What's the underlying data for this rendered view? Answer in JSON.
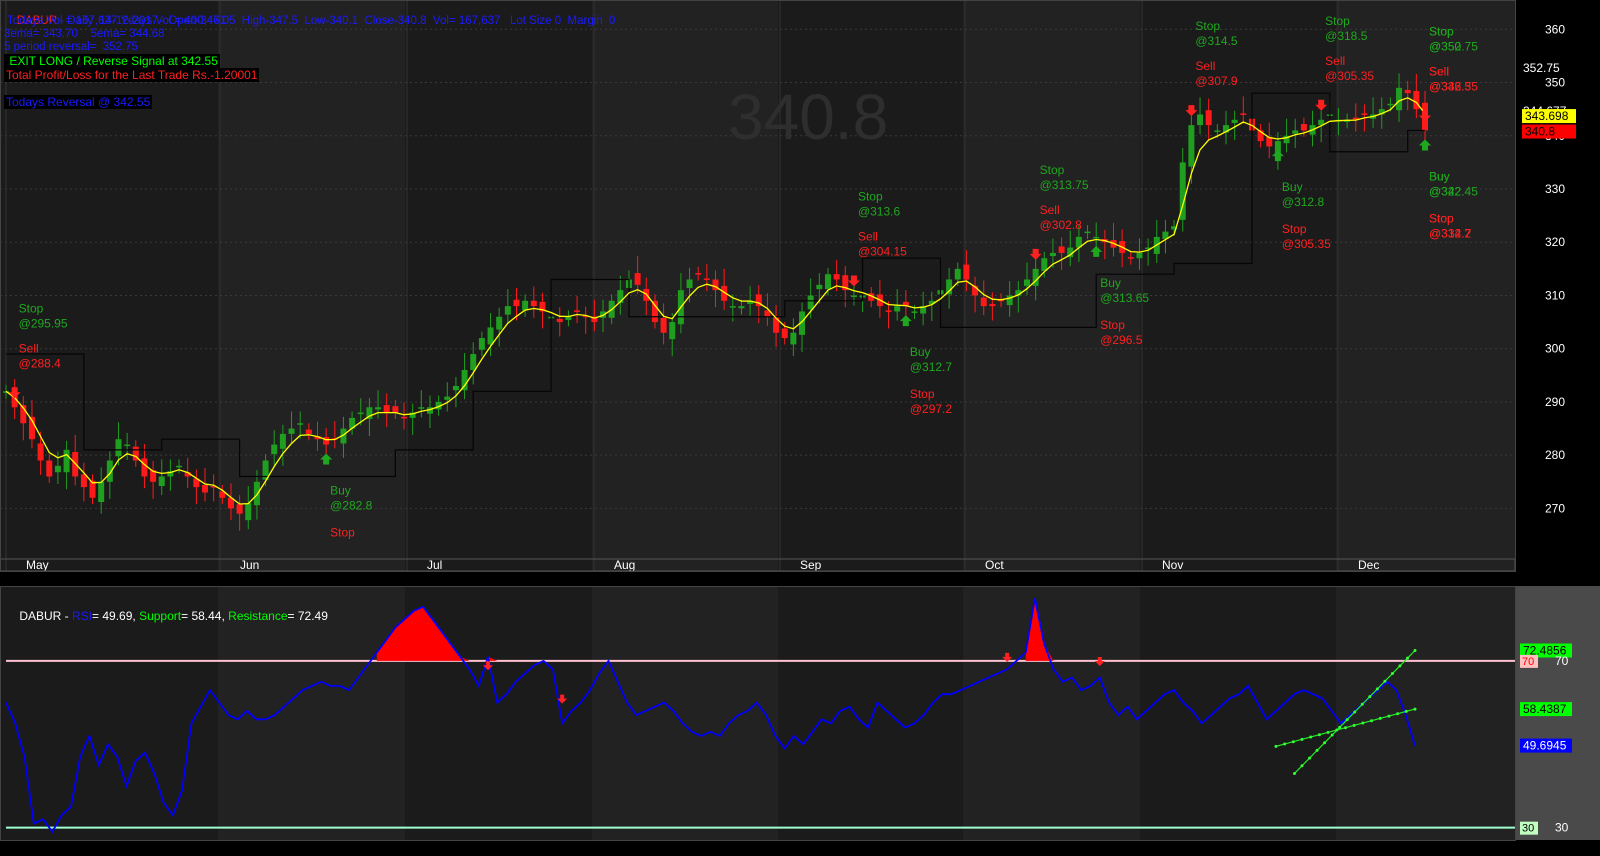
{
  "header": {
    "symbol": "DABUR",
    "info": " - Daily  14-12-2017 - Open-347.05  High-347.5  Low-340.1  Close-340.8  Vol= 167,637   Lot Size 0  Margin  0",
    "volume_line": " Todays Vol = 167,637 Ydays Vol = 400,461",
    "ema_line": "3ema= 343.70    5ema= 344.68",
    "reversal_line": "5 period reversal=  352.75",
    "exit_signal": " EXIT LONG / Reverse Signal at 342.55",
    "profit_loss": "Total Profit/Loss for the Last Trade Rs.-1.20001",
    "todays_reversal": "Todays Reversal @ 342.55",
    "watermark": "340.8"
  },
  "colors": {
    "background": "#000000",
    "panel": "#1a1a1a",
    "up_candle": "#1f9e1f",
    "down_candle": "#ff1a1a",
    "ema": "#ffff00",
    "stop_line": "#000000",
    "buy_text": "#1fa81f",
    "sell_text": "#ff2020",
    "rsi_line": "#0000ff",
    "axis_text": "#ffffff"
  },
  "chart_data": [
    {
      "type": "candlestick",
      "title": "DABUR - Daily",
      "x_months": [
        "May",
        "Jun",
        "Jul",
        "Aug",
        "Sep",
        "Oct",
        "Nov",
        "Dec"
      ],
      "y_ticks": [
        270,
        280,
        290,
        300,
        310,
        320,
        330,
        340,
        350,
        360
      ],
      "ylim": [
        262,
        364
      ],
      "series_closes": [
        292,
        289,
        286,
        283,
        279,
        276,
        278,
        281,
        276,
        274,
        272,
        275,
        279,
        283,
        282,
        279,
        276,
        275,
        276,
        277,
        278,
        276,
        274,
        273,
        274,
        272,
        270,
        269,
        271,
        275,
        279,
        282,
        284,
        285,
        286,
        284,
        283,
        282,
        283,
        285,
        287,
        288,
        289,
        289,
        288,
        288,
        287,
        288,
        289,
        289,
        290,
        291,
        293,
        296,
        299,
        302,
        304,
        306,
        308,
        308,
        309,
        308,
        307,
        306,
        305,
        306,
        307,
        306,
        305,
        307,
        309,
        311,
        313,
        312,
        309,
        305,
        303,
        305,
        311,
        313,
        314,
        313,
        311,
        309,
        308,
        308,
        309,
        308,
        306,
        303,
        302,
        303,
        307,
        310,
        312,
        314,
        313,
        311,
        310,
        310,
        309,
        308,
        307,
        308,
        308,
        307,
        308,
        309,
        311,
        313,
        315,
        313,
        310,
        308,
        308,
        309,
        310,
        311,
        313,
        315,
        317,
        318,
        318,
        319,
        321,
        322,
        321,
        320,
        319,
        318,
        317,
        318,
        319,
        321,
        322,
        323,
        335,
        342,
        344,
        342,
        341,
        342,
        343,
        344,
        341,
        339,
        338,
        339,
        340,
        341,
        341,
        342,
        343,
        344,
        343,
        343,
        343,
        344,
        344,
        345,
        346,
        349,
        348,
        345,
        341
      ],
      "ema_color": "#ffff00",
      "last_close": 340.8,
      "price_labels": [
        {
          "text": "352.75",
          "value": 352.75
        },
        {
          "text": "344.677",
          "value": 344.677
        },
        {
          "text": "343.698",
          "value": 343.698,
          "bg": "#ffff00",
          "fg": "#000000"
        },
        {
          "text": "340.8",
          "value": 340.8,
          "bg": "#ff0000",
          "fg": "#000000"
        }
      ],
      "signals": [
        {
          "kind": "Stop",
          "text": "@295.95",
          "series": "sell",
          "idx": 1,
          "place": "above2"
        },
        {
          "kind": "Sell",
          "text": "@288.4",
          "series": "sell",
          "idx": 1,
          "place": "above"
        },
        {
          "kind": "Buy",
          "text": "@282.8",
          "series": "buy",
          "idx": 37,
          "place": "below"
        },
        {
          "kind": "Stop",
          "text": "",
          "series": "sell",
          "idx": 37,
          "place": "below2"
        },
        {
          "kind": "Stop",
          "text": "@313.6",
          "series": "buy",
          "idx": 98,
          "place": "above2"
        },
        {
          "kind": "Sell",
          "text": "@304.15",
          "series": "sell",
          "idx": 98,
          "place": "above"
        },
        {
          "kind": "Buy",
          "text": "@312.7",
          "series": "buy",
          "idx": 104,
          "place": "below"
        },
        {
          "kind": "Stop",
          "text": "@297.2",
          "series": "sell",
          "idx": 104,
          "place": "below2"
        },
        {
          "kind": "Stop",
          "text": "@313.75",
          "series": "buy",
          "idx": 119,
          "place": "above2"
        },
        {
          "kind": "Sell",
          "text": "@302.8",
          "series": "sell",
          "idx": 119,
          "place": "above"
        },
        {
          "kind": "Buy",
          "text": "@313.65",
          "series": "buy",
          "idx": 126,
          "place": "below"
        },
        {
          "kind": "Stop",
          "text": "@296.5",
          "series": "sell",
          "idx": 126,
          "place": "below2"
        },
        {
          "kind": "Stop",
          "text": "@314.5",
          "series": "buy",
          "idx": 137,
          "place": "above2"
        },
        {
          "kind": "Sell",
          "text": "@307.9",
          "series": "sell",
          "idx": 137,
          "place": "above"
        },
        {
          "kind": "Buy",
          "text": "@312.8",
          "series": "buy",
          "idx": 147,
          "place": "below"
        },
        {
          "kind": "Stop",
          "text": "@305.35",
          "series": "sell",
          "idx": 147,
          "place": "below2"
        },
        {
          "kind": "Stop",
          "text": "@318.5",
          "series": "buy",
          "idx": 152,
          "place": "above2"
        },
        {
          "kind": "Sell",
          "text": "@305.35",
          "series": "sell",
          "idx": 152,
          "place": "above"
        },
        {
          "kind": "Buy",
          "text": "@322.45",
          "series": "buy",
          "idx": 171,
          "place": "below"
        },
        {
          "kind": "Stop",
          "text": "@312.2",
          "series": "sell",
          "idx": 171,
          "place": "below2"
        },
        {
          "kind": "Stop",
          "text": "@350",
          "series": "buy",
          "idx": 206,
          "place": "above2"
        },
        {
          "kind": "Sell",
          "text": "@336.3",
          "series": "sell",
          "idx": 206,
          "place": "above"
        },
        {
          "kind": "Buy",
          "text": "@342",
          "series": "buy",
          "idx": 217,
          "place": "below"
        },
        {
          "kind": "Stop",
          "text": "@334.7",
          "series": "sell",
          "idx": 217,
          "place": "below2"
        },
        {
          "kind": "Stop",
          "text": "@352.75",
          "series": "buy",
          "idx": 238,
          "place": "above2"
        },
        {
          "kind": "Sell",
          "text": "@342.55",
          "series": "sell",
          "idx": 238,
          "place": "above"
        }
      ]
    },
    {
      "type": "line",
      "title": "RSI",
      "legend": {
        "symbol": "DABUR - ",
        "rsi_label": "RSI",
        "rsi_value": "= 49.69",
        "support_label": "Support",
        "support_value": "= 58.44",
        "resistance_label": "Resistance",
        "resistance_value": "= 72.49"
      },
      "levels": [
        70,
        30
      ],
      "ylim": [
        28,
        87
      ],
      "rsi": [
        60,
        55,
        47,
        31,
        32,
        29,
        33,
        35,
        47,
        52,
        45,
        50,
        47,
        40,
        46,
        48,
        43,
        36,
        33,
        39,
        55,
        59,
        63,
        60,
        57,
        56,
        58,
        56,
        56,
        57,
        59,
        61,
        63,
        64,
        65,
        64,
        64,
        63,
        66,
        69,
        72,
        75,
        78,
        80,
        82,
        83,
        80,
        77,
        74,
        71,
        68,
        64,
        71,
        60,
        62,
        65,
        67,
        69,
        70,
        68,
        55,
        58,
        60,
        63,
        67,
        70,
        65,
        60,
        57,
        58,
        59,
        60,
        58,
        55,
        53,
        52,
        53,
        52,
        55,
        57,
        58,
        60,
        57,
        52,
        49,
        52,
        50,
        53,
        56,
        55,
        58,
        59,
        56,
        54,
        60,
        58,
        56,
        54,
        55,
        57,
        60,
        62,
        62,
        63,
        64,
        65,
        66,
        67,
        68,
        70,
        72,
        85,
        74,
        68,
        65,
        66,
        63,
        64,
        66,
        60,
        57,
        59,
        56,
        58,
        60,
        62,
        63,
        60,
        58,
        55,
        57,
        59,
        61,
        62,
        64,
        60,
        56,
        58,
        60,
        62,
        63,
        62,
        61,
        58,
        55,
        57,
        59,
        61,
        63,
        65,
        63,
        57,
        49.69
      ],
      "level_labels": [
        {
          "text": "72.4856",
          "value": 72.49,
          "bg": "#00ff00",
          "fg": "#000000"
        },
        {
          "text": "70",
          "value": 70,
          "bg": "#ffc0c0",
          "fg": "#ff0000"
        },
        {
          "text": "70",
          "value": 70,
          "bg": "",
          "fg": "#ffffff"
        },
        {
          "text": "58.4387",
          "value": 58.44,
          "bg": "#00ff00",
          "fg": "#000000"
        },
        {
          "text": "49.6945",
          "value": 49.69,
          "bg": "#0000ff",
          "fg": "#ffffff"
        },
        {
          "text": "30",
          "value": 30,
          "bg": "#c0ffc0",
          "fg": "#000000"
        },
        {
          "text": "30",
          "value": 30,
          "bg": "",
          "fg": "#ffffff"
        }
      ]
    }
  ]
}
